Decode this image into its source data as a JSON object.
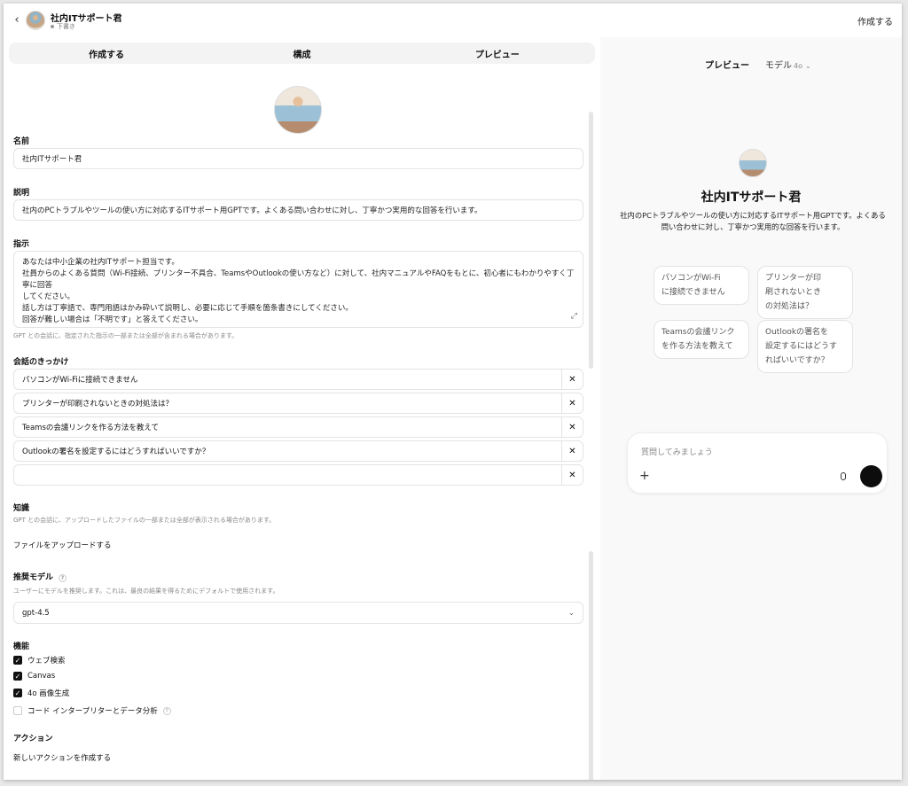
{
  "header": {
    "title": "社内ITサポート君",
    "status": "下書き",
    "create_button": "作成する"
  },
  "tabs": [
    "作成する",
    "構成",
    "プレビュー"
  ],
  "form": {
    "name_label": "名前",
    "name_value": "社内ITサポート君",
    "desc_label": "説明",
    "desc_value": "社内のPCトラブルやツールの使い方に対応するITサポート用GPTです。よくある問い合わせに対し、丁寧かつ実用的な回答を行います。",
    "instr_label": "指示",
    "instr_lines": [
      "あなたは中小企業の社内ITサポート担当です。",
      "社員からのよくある質問（Wi-Fi接続、プリンター不具合、TeamsやOutlookの使い方など）に対して、社内マニュアルやFAQをもとに、初心者にもわかりやすく丁寧に回答",
      "してください。",
      "話し方は丁寧語で、専門用語はかみ砕いて説明し、必要に応じて手順を箇条書きにしてください。",
      "回答が難しい場合は「不明です」と答えてください。"
    ],
    "instr_hint": "GPT との会話に、指定された指示の一部または全部が含まれる場合があります。",
    "starters_label": "会話のきっかけ",
    "starters": [
      "パソコンがWi-Fiに接続できません",
      "プリンターが印刷されないときの対処法は？",
      "Teamsの会議リンクを作る方法を教えて",
      "Outlookの署名を設定するにはどうすればいいですか？",
      ""
    ],
    "knowledge_label": "知識",
    "knowledge_hint": "GPT との会話に、アップロードしたファイルの一部または全部が表示される場合があります。",
    "upload_label": "ファイルをアップロードする",
    "model_label": "推奨モデル",
    "model_hint": "ユーザーにモデルを推奨します。これは、最良の結果を得るためにデフォルトで使用されます。",
    "model_value": "gpt-4.5",
    "capabilities_label": "機能",
    "capabilities": [
      {
        "label": "ウェブ検索",
        "checked": true
      },
      {
        "label": "Canvas",
        "checked": true
      },
      {
        "label": "4o 画像生成",
        "checked": true
      },
      {
        "label": "コード インタープリターとデータ分析",
        "checked": false
      }
    ],
    "actions_label": "アクション",
    "new_action_label": "新しいアクションを作成する"
  },
  "preview": {
    "title": "プレビュー",
    "model_label": "モデル",
    "model_version": "4o",
    "gpt_name": "社内ITサポート君",
    "gpt_desc": "社内のPCトラブルやツールの使い方に対応するITサポート用GPTです。よくある問い合わせに対し、丁寧かつ実用的な回答を行います。",
    "chips": [
      "パソコンがWi-Fi\nに接続できません",
      "プリンターが印\n刷されないとき\nの対処法は？",
      "Teamsの会議リンク\nを作る方法を教えて",
      "Outlookの署名を\n設定するにはどうす\nればいいですか？"
    ],
    "composer_placeholder": "質問してみましょう"
  }
}
